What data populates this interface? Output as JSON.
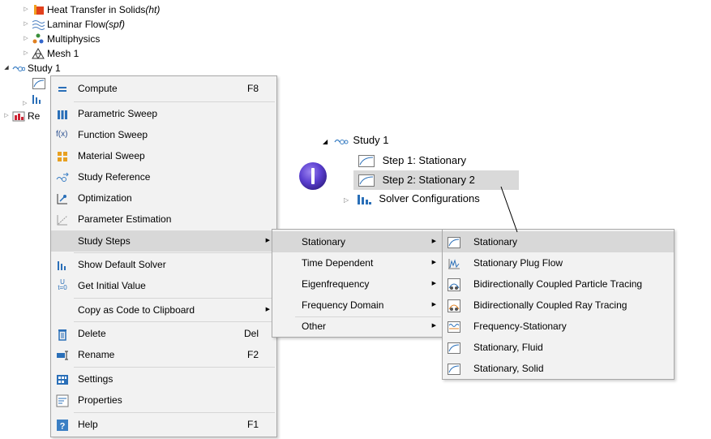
{
  "tree": {
    "heat_transfer": {
      "label": "Heat Transfer in Solids ",
      "tag": "(ht)"
    },
    "laminar_flow": {
      "label": "Laminar Flow ",
      "tag": "(spf)"
    },
    "multiphysics": "Multiphysics",
    "mesh": "Mesh 1",
    "study": "Study 1",
    "results_partial": "Re"
  },
  "context_menu": {
    "items": [
      {
        "label": "Compute",
        "shortcut": "F8",
        "icon": "equals-icon"
      },
      {
        "label": "Parametric Sweep",
        "icon": "parametric-sweep-icon"
      },
      {
        "label": "Function Sweep",
        "icon": "function-sweep-icon"
      },
      {
        "label": "Material Sweep",
        "icon": "material-sweep-icon"
      },
      {
        "label": "Study Reference",
        "icon": "study-reference-icon"
      },
      {
        "label": "Optimization",
        "icon": "optimization-icon"
      },
      {
        "label": "Parameter Estimation",
        "icon": "parameter-estimation-icon"
      },
      {
        "label": "Study Steps",
        "icon": ""
      },
      {
        "label": "Show Default Solver",
        "icon": "solver-icon"
      },
      {
        "label": "Get Initial Value",
        "icon": "initial-value-icon"
      },
      {
        "label": "Copy as Code to Clipboard",
        "icon": ""
      },
      {
        "label": "Delete",
        "shortcut": "Del",
        "icon": "trash-icon"
      },
      {
        "label": "Rename",
        "shortcut": "F2",
        "icon": "rename-icon"
      },
      {
        "label": "Settings",
        "icon": "settings-icon"
      },
      {
        "label": "Properties",
        "icon": "properties-icon"
      },
      {
        "label": "Help",
        "shortcut": "F1",
        "icon": "help-icon"
      }
    ]
  },
  "study_steps_submenu": {
    "items": [
      "Stationary",
      "Time Dependent",
      "Eigenfrequency",
      "Frequency Domain",
      "Other"
    ]
  },
  "stationary_submenu": {
    "items": [
      "Stationary",
      "Stationary Plug Flow",
      "Bidirectionally Coupled Particle Tracing",
      "Bidirectionally Coupled Ray Tracing",
      "Frequency-Stationary",
      "Stationary, Fluid",
      "Stationary, Solid"
    ]
  },
  "callout": {
    "study": "Study 1",
    "step1": "Step 1: Stationary",
    "step2": "Step 2: Stationary 2",
    "solver": "Solver Configurations"
  },
  "colors": {
    "marker": "#5b3fd0",
    "highlight": "#d8d8d8",
    "menu_bg": "#f2f2f2"
  }
}
